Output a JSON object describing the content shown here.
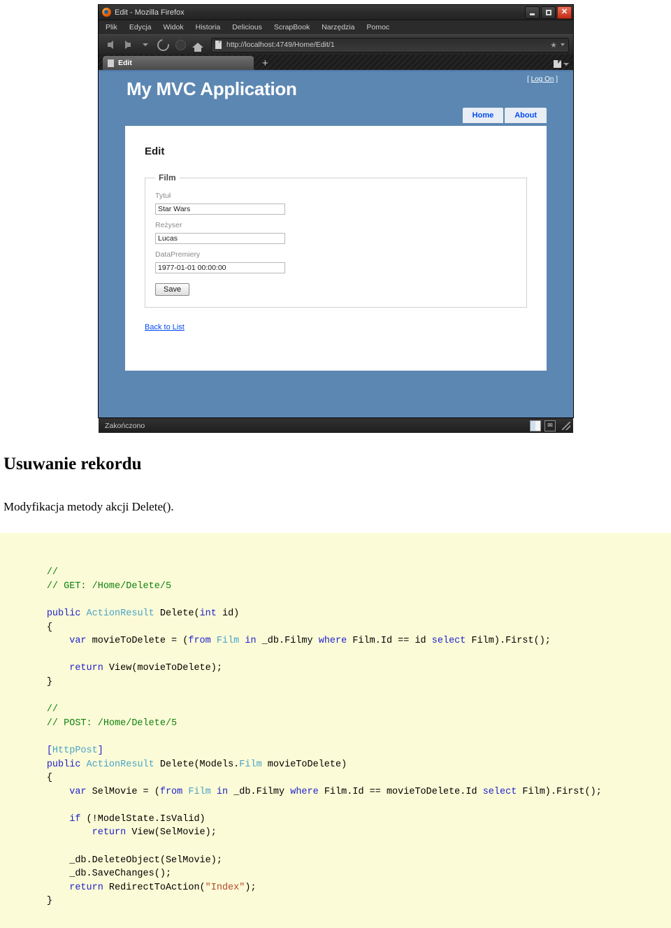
{
  "browser": {
    "window_title": "Edit - Mozilla Firefox",
    "menu": [
      {
        "label": "Plik",
        "underline": "P"
      },
      {
        "label": "Edycja",
        "underline": "E"
      },
      {
        "label": "Widok",
        "underline": "W"
      },
      {
        "label": "Historia",
        "underline": "H"
      },
      {
        "label": "Delicious",
        "underline": "D"
      },
      {
        "label": "ScrapBook",
        "underline": "S"
      },
      {
        "label": "Narzędzia",
        "underline": "N"
      },
      {
        "label": "Pomoc",
        "underline": "c"
      }
    ],
    "url": "http://localhost:4749/Home/Edit/1",
    "tab_label": "Edit",
    "new_tab_glyph": "+",
    "star_glyph": "★",
    "status_text": "Zakończono",
    "window_buttons": {
      "minimize": "—",
      "maximize": "□",
      "close": "✕"
    }
  },
  "page": {
    "logon": "[ Log On ]",
    "logon_label": "Log On",
    "site_title": "My MVC Application",
    "nav_tabs": [
      {
        "label": "Home"
      },
      {
        "label": "About"
      }
    ],
    "card_title": "Edit",
    "fieldset_legend": "Film",
    "fields": [
      {
        "label": "Tytuł",
        "value": "Star Wars"
      },
      {
        "label": "Reżyser",
        "value": "Lucas"
      },
      {
        "label": "DataPremiery",
        "value": "1977-01-01 00:00:00"
      }
    ],
    "save_button": "Save",
    "back_link": "Back to List",
    "accent_color": "#5c87b2",
    "link_color": "#034af3"
  },
  "document": {
    "heading": "Usuwanie rekordu",
    "paragraph": "Modyfikacja metody akcji Delete()."
  },
  "code": {
    "language": "csharp",
    "background": "#fbfbd7",
    "lines": [
      [
        {
          "t": "        ",
          "c": "plain"
        },
        {
          "t": "//",
          "c": "comment"
        }
      ],
      [
        {
          "t": "        ",
          "c": "plain"
        },
        {
          "t": "// GET: /Home/Delete/5",
          "c": "comment"
        }
      ],
      [
        {
          "t": "",
          "c": "plain"
        }
      ],
      [
        {
          "t": "        ",
          "c": "plain"
        },
        {
          "t": "public",
          "c": "kw"
        },
        {
          "t": " ",
          "c": "plain"
        },
        {
          "t": "ActionResult",
          "c": "type"
        },
        {
          "t": " Delete(",
          "c": "plain"
        },
        {
          "t": "int",
          "c": "kw"
        },
        {
          "t": " id)",
          "c": "plain"
        }
      ],
      [
        {
          "t": "        {",
          "c": "plain"
        }
      ],
      [
        {
          "t": "            ",
          "c": "plain"
        },
        {
          "t": "var",
          "c": "kw"
        },
        {
          "t": " movieToDelete = (",
          "c": "plain"
        },
        {
          "t": "from",
          "c": "kw"
        },
        {
          "t": " ",
          "c": "plain"
        },
        {
          "t": "Film",
          "c": "type"
        },
        {
          "t": " ",
          "c": "plain"
        },
        {
          "t": "in",
          "c": "kw"
        },
        {
          "t": " _db.Filmy ",
          "c": "plain"
        },
        {
          "t": "where",
          "c": "kw"
        },
        {
          "t": " Film.Id == id ",
          "c": "plain"
        },
        {
          "t": "select",
          "c": "kw"
        },
        {
          "t": " Film).First();",
          "c": "plain"
        }
      ],
      [
        {
          "t": "",
          "c": "plain"
        }
      ],
      [
        {
          "t": "            ",
          "c": "plain"
        },
        {
          "t": "return",
          "c": "kw"
        },
        {
          "t": " View(movieToDelete);",
          "c": "plain"
        }
      ],
      [
        {
          "t": "        }",
          "c": "plain"
        }
      ],
      [
        {
          "t": "",
          "c": "plain"
        }
      ],
      [
        {
          "t": "        ",
          "c": "plain"
        },
        {
          "t": "//",
          "c": "comment"
        }
      ],
      [
        {
          "t": "        ",
          "c": "plain"
        },
        {
          "t": "// POST: /Home/Delete/5",
          "c": "comment"
        }
      ],
      [
        {
          "t": "",
          "c": "plain"
        }
      ],
      [
        {
          "t": "        ",
          "c": "plain"
        },
        {
          "t": "[",
          "c": "punct"
        },
        {
          "t": "HttpPost",
          "c": "attr"
        },
        {
          "t": "]",
          "c": "punct"
        }
      ],
      [
        {
          "t": "        ",
          "c": "plain"
        },
        {
          "t": "public",
          "c": "kw"
        },
        {
          "t": " ",
          "c": "plain"
        },
        {
          "t": "ActionResult",
          "c": "type"
        },
        {
          "t": " Delete(Models.",
          "c": "plain"
        },
        {
          "t": "Film",
          "c": "type"
        },
        {
          "t": " movieToDelete)",
          "c": "plain"
        }
      ],
      [
        {
          "t": "        {",
          "c": "plain"
        }
      ],
      [
        {
          "t": "            ",
          "c": "plain"
        },
        {
          "t": "var",
          "c": "kw"
        },
        {
          "t": " SelMovie = (",
          "c": "plain"
        },
        {
          "t": "from",
          "c": "kw"
        },
        {
          "t": " ",
          "c": "plain"
        },
        {
          "t": "Film",
          "c": "type"
        },
        {
          "t": " ",
          "c": "plain"
        },
        {
          "t": "in",
          "c": "kw"
        },
        {
          "t": " _db.Filmy ",
          "c": "plain"
        },
        {
          "t": "where",
          "c": "kw"
        },
        {
          "t": " Film.Id == movieToDelete.Id ",
          "c": "plain"
        },
        {
          "t": "select",
          "c": "kw"
        },
        {
          "t": " Film).First();",
          "c": "plain"
        }
      ],
      [
        {
          "t": "",
          "c": "plain"
        }
      ],
      [
        {
          "t": "            ",
          "c": "plain"
        },
        {
          "t": "if",
          "c": "kw"
        },
        {
          "t": " (!ModelState.IsValid)",
          "c": "plain"
        }
      ],
      [
        {
          "t": "                ",
          "c": "plain"
        },
        {
          "t": "return",
          "c": "kw"
        },
        {
          "t": " View(SelMovie);",
          "c": "plain"
        }
      ],
      [
        {
          "t": "",
          "c": "plain"
        }
      ],
      [
        {
          "t": "            _db.DeleteObject(SelMovie);",
          "c": "plain"
        }
      ],
      [
        {
          "t": "            _db.SaveChanges();",
          "c": "plain"
        }
      ],
      [
        {
          "t": "            ",
          "c": "plain"
        },
        {
          "t": "return",
          "c": "kw"
        },
        {
          "t": " RedirectToAction(",
          "c": "plain"
        },
        {
          "t": "\"Index\"",
          "c": "str"
        },
        {
          "t": ");",
          "c": "plain"
        }
      ],
      [
        {
          "t": "        }",
          "c": "plain"
        }
      ]
    ]
  }
}
